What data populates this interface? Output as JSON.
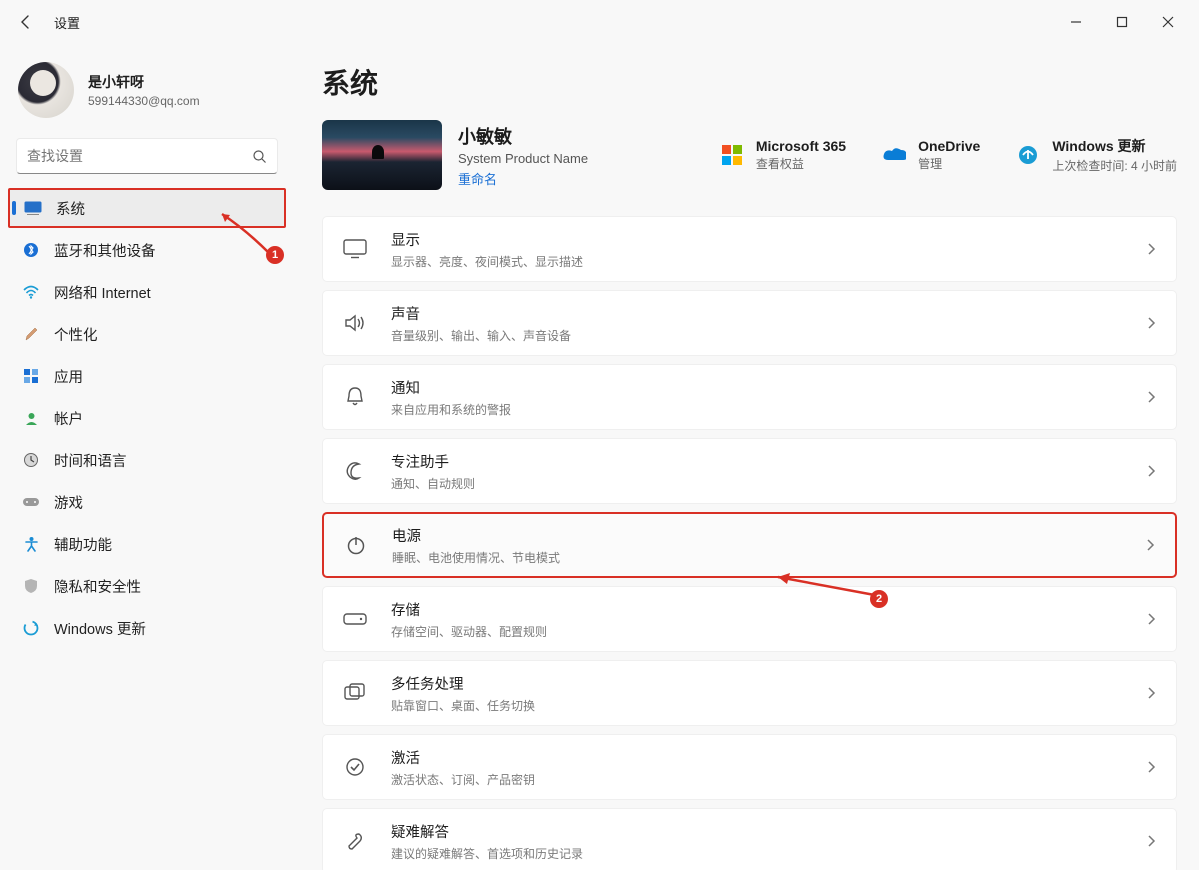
{
  "app": {
    "title": "设置"
  },
  "profile": {
    "name": "是小轩呀",
    "email": "599144330@qq.com"
  },
  "search": {
    "placeholder": "查找设置"
  },
  "sidebar": {
    "items": [
      {
        "label": "系统"
      },
      {
        "label": "蓝牙和其他设备"
      },
      {
        "label": "网络和 Internet"
      },
      {
        "label": "个性化"
      },
      {
        "label": "应用"
      },
      {
        "label": "帐户"
      },
      {
        "label": "时间和语言"
      },
      {
        "label": "游戏"
      },
      {
        "label": "辅助功能"
      },
      {
        "label": "隐私和安全性"
      },
      {
        "label": "Windows 更新"
      }
    ]
  },
  "page": {
    "title": "系统"
  },
  "device": {
    "name": "小敏敏",
    "sub": "System Product Name",
    "rename": "重命名",
    "chips": [
      {
        "name": "Microsoft 365",
        "sub": "查看权益"
      },
      {
        "name": "OneDrive",
        "sub": "管理"
      },
      {
        "name": "Windows 更新",
        "sub": "上次检查时间: 4 小时前"
      }
    ]
  },
  "tiles": [
    {
      "title": "显示",
      "desc": "显示器、亮度、夜间模式、显示描述"
    },
    {
      "title": "声音",
      "desc": "音量级别、输出、输入、声音设备"
    },
    {
      "title": "通知",
      "desc": "来自应用和系统的警报"
    },
    {
      "title": "专注助手",
      "desc": "通知、自动规则"
    },
    {
      "title": "电源",
      "desc": "睡眠、电池使用情况、节电模式"
    },
    {
      "title": "存储",
      "desc": "存储空间、驱动器、配置规则"
    },
    {
      "title": "多任务处理",
      "desc": "贴靠窗口、桌面、任务切换"
    },
    {
      "title": "激活",
      "desc": "激活状态、订阅、产品密钥"
    },
    {
      "title": "疑难解答",
      "desc": "建议的疑难解答、首选项和历史记录"
    }
  ],
  "annotations": {
    "1": "1",
    "2": "2"
  },
  "colors": {
    "accent": "#1a6fd4",
    "highlight": "#d93025"
  }
}
